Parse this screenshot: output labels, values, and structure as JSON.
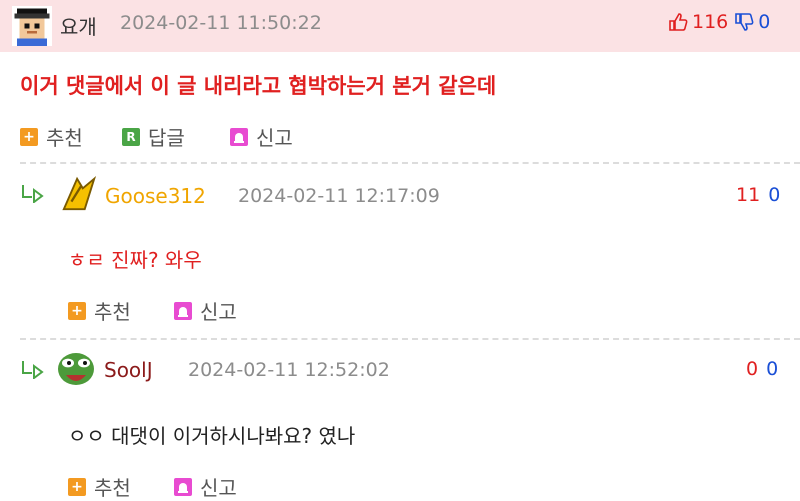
{
  "post": {
    "author": "요개",
    "date": "2024-02-11 11:50:22",
    "upvotes": "116",
    "downvotes": "0",
    "body": "이거 댓글에서 이 글 내리라고 협박하는거 본거 같은데",
    "actions": {
      "recommend": "추천",
      "reply": "답글",
      "report": "신고"
    },
    "colors": {
      "background": "#fbe2e4",
      "body_text": "#e02020"
    }
  },
  "comments": [
    {
      "author": "Goose312",
      "author_color": "#f0a500",
      "date": "2024-02-11 12:17:09",
      "upvotes": "11",
      "downvotes": "0",
      "body": "ㅎㄹ 진짜? 와우",
      "body_color": "#e02020",
      "avatar_icon": "goose-icon",
      "actions": {
        "recommend": "추천",
        "report": "신고"
      }
    },
    {
      "author": "SoolJ",
      "author_color": "#8b1a1a",
      "date": "2024-02-11 12:52:02",
      "upvotes": "0",
      "downvotes": "0",
      "body": "ㅇㅇ 대댓이 이거하시나봐요? 였나",
      "body_color": "#222222",
      "avatar_icon": "pepe-icon",
      "actions": {
        "recommend": "추천",
        "report": "신고"
      }
    }
  ]
}
